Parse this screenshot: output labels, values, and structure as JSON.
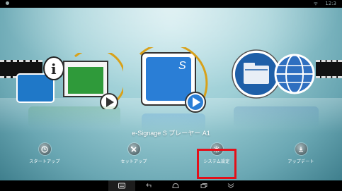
{
  "app_title": "e-Signage S プレーヤー A1",
  "status_bar": {
    "time": "12:3",
    "wifi": "WiFi"
  },
  "bottom_nav": {
    "items": [
      {
        "label": "スタートアップ",
        "icon": "clock-icon"
      },
      {
        "label": "セットアップ",
        "icon": "tools-icon"
      },
      {
        "label": "システム設定",
        "icon": "gear-icon"
      },
      {
        "label": "アップデート",
        "icon": "download-icon"
      }
    ]
  },
  "center_icon_letter": "S",
  "colors": {
    "highlight": "#e3101a",
    "background_top": "#bfe3e8",
    "background_bottom": "#3f7f8d",
    "center_icon_blue": "#2a7ed6",
    "ring_gold": "#d8a11a"
  }
}
